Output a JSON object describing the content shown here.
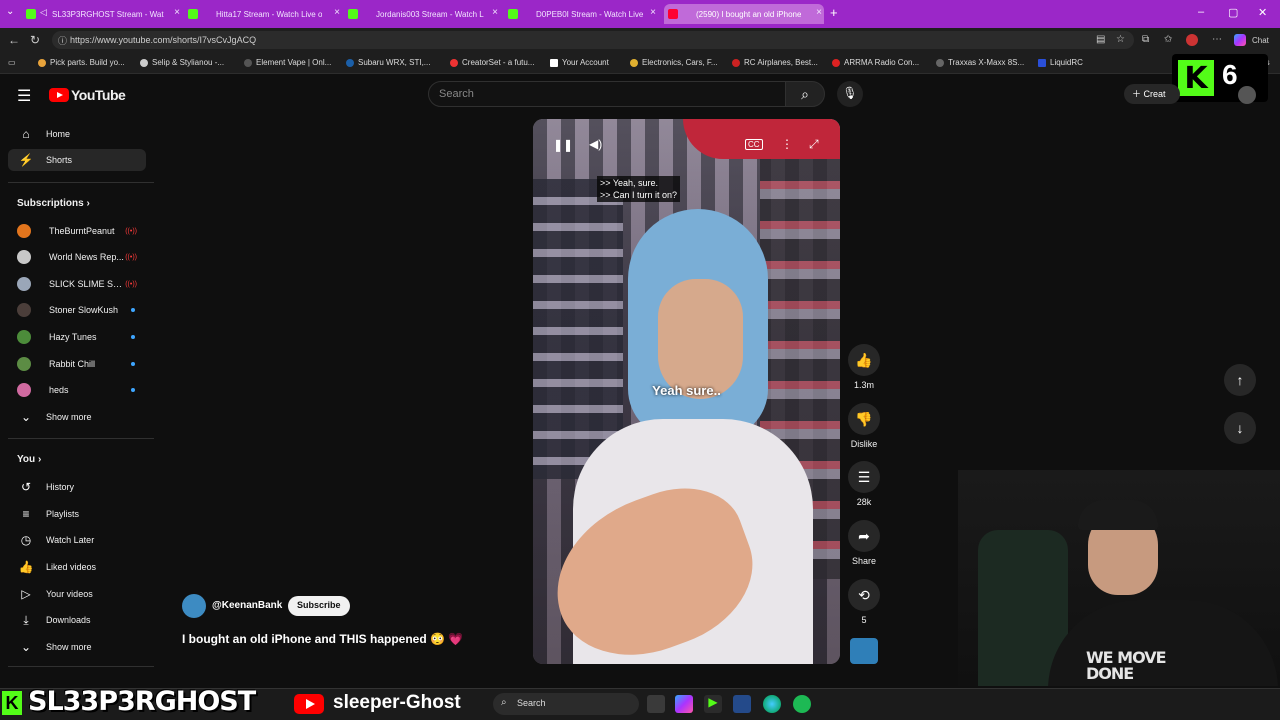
{
  "browser": {
    "tabs": [
      {
        "title": "SL33P3RGHOST Stream - Wat",
        "icon": "kick-icon"
      },
      {
        "title": "Hitta17 Stream - Watch Live o",
        "icon": "kick-icon"
      },
      {
        "title": "Jordanis003 Stream - Watch L",
        "icon": "kick-icon"
      },
      {
        "title": "D0PEB0I Stream - Watch Live",
        "icon": "kick-icon"
      },
      {
        "title": "(2590) I bought an old iPhone",
        "icon": "youtube-icon",
        "active": true
      }
    ],
    "new_tab": "+",
    "url": "https://www.youtube.com/shorts/I7vsCvJgACQ",
    "chat_label": "Chat",
    "bookmarks": [
      "Pick parts. Build yo...",
      "Selip & Stylianou -...",
      "Element Vape | Onl...",
      "Subaru WRX, STI,...",
      "CreatorSet - a futu...",
      "Your Account",
      "Electronics, Cars, F...",
      "RC Airplanes, Best...",
      "ARRMA Radio Con...",
      "Traxxas X-Maxx 8S...",
      "LiquidRC"
    ],
    "bookmarks_more": "orites"
  },
  "kick_badge": {
    "letter": "K",
    "count": "6"
  },
  "youtube": {
    "logo_text": "YouTube",
    "search_placeholder": "Search",
    "create_label": "Creat",
    "nav": [
      {
        "label": "Home",
        "icon": "home-icon"
      },
      {
        "label": "Shorts",
        "icon": "shorts-icon",
        "selected": true
      }
    ],
    "subscriptions_heading": "Subscriptions",
    "subscriptions": [
      {
        "name": "TheBurntPeanut",
        "status": "live"
      },
      {
        "name": "World News Rep...",
        "status": "live"
      },
      {
        "name": "SLICK SLIME SA...",
        "status": "live"
      },
      {
        "name": "Stoner SlowKush",
        "status": "new"
      },
      {
        "name": "Hazy Tunes",
        "status": "new"
      },
      {
        "name": "Rabbit Chill",
        "status": "new"
      },
      {
        "name": "heds",
        "status": "new"
      }
    ],
    "show_more": "Show more",
    "you_heading": "You",
    "you_items": [
      {
        "label": "History",
        "icon": "history-icon"
      },
      {
        "label": "Playlists",
        "icon": "playlists-icon"
      },
      {
        "label": "Watch Later",
        "icon": "clock-icon"
      },
      {
        "label": "Liked videos",
        "icon": "thumb-up-icon"
      },
      {
        "label": "Your videos",
        "icon": "video-icon"
      },
      {
        "label": "Downloads",
        "icon": "download-icon"
      },
      {
        "label": "Show more",
        "icon": "chevron-down-icon"
      }
    ],
    "short": {
      "caption_line1": ">> Yeah, sure.",
      "caption_line2": ">> Can I turn it on?",
      "subtitle": "Yeah sure..",
      "channel_handle": "@KeenanBank",
      "subscribe_label": "Subscribe",
      "title": "I bought an old iPhone and THIS happened 😳 💗",
      "actions": {
        "likes": "1.3m",
        "dislike_label": "Dislike",
        "comments": "28k",
        "share_label": "Share",
        "remix_count": "5"
      }
    }
  },
  "overlay": {
    "kick_name": "SL33P3RGHOST",
    "youtube_name": "sleeper-Ghost",
    "shirt_text": "WE MOVE\nDONE"
  },
  "taskbar": {
    "search_label": "Search"
  },
  "colors": {
    "tabbar": "#9b27c8",
    "kick_green": "#53fc18",
    "youtube_red": "#ff0000",
    "page_bg": "#0f0f0f"
  }
}
